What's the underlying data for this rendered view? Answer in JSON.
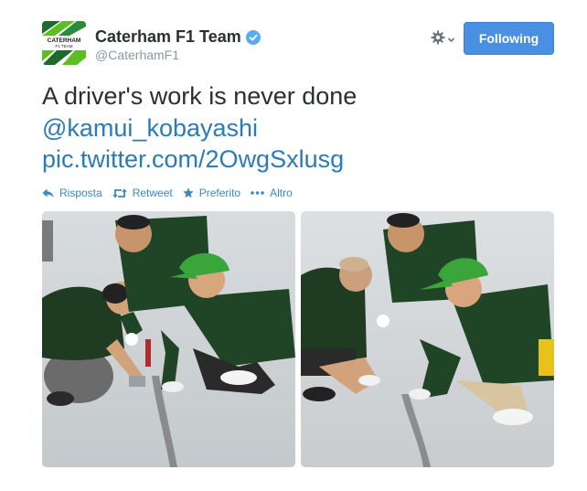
{
  "header": {
    "display_name": "Caterham F1 Team",
    "handle": "@CaterhamF1",
    "avatar_text": [
      "CATERHAM",
      "F1 TEAM"
    ],
    "follow_label": "Following"
  },
  "tweet": {
    "line1": "A driver's work is never done",
    "mention": "@kamui_kobayashi",
    "pic_link": "pic.twitter.com/2OwgSxlusg"
  },
  "actions": {
    "reply": "Risposta",
    "retweet": "Retweet",
    "favorite": "Preferito",
    "more": "Altro"
  },
  "icons": {
    "verified": "verified-badge-icon",
    "settings": "gear-icon",
    "reply": "reply-icon",
    "retweet": "retweet-icon",
    "favorite": "star-icon",
    "more": "ellipsis-icon"
  },
  "colors": {
    "link": "#2b7bb9",
    "follow_button": "#4a90e2",
    "brand_green": "#5bbf21"
  }
}
